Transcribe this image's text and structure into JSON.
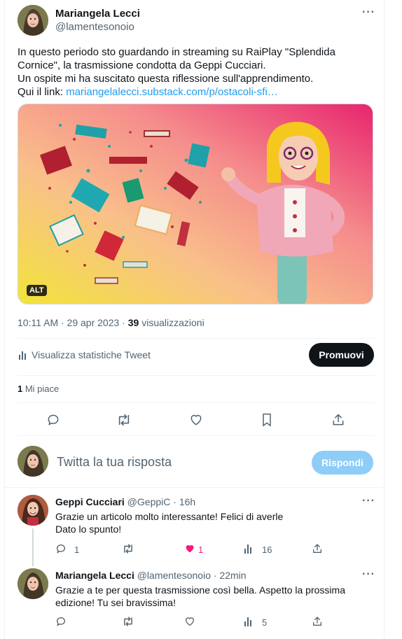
{
  "main_tweet": {
    "author_name": "Mariangela Lecci",
    "author_handle": "@lamentesonoio",
    "text_line1": "In questo periodo sto guardando in streaming su RaiPlay \"Splendida",
    "text_line2": "Cornice\", la trasmissione condotta da Geppi Cucciari.",
    "text_line3": "Un ospite mi ha suscitato questa riflessione sull'apprendimento.",
    "text_line4_prefix": "Qui il link: ",
    "text_link": "mariangelalecci.substack.com/p/ostacoli-sfi…",
    "alt_badge": "ALT",
    "timestamp": "10:11 AM · 29 apr 2023 · ",
    "views_count": "39",
    "views_label": " visualizzazioni",
    "stats_label": "Visualizza statistiche Tweet",
    "promote_label": "Promuovi",
    "likes_count": "1",
    "likes_label": " Mi piace"
  },
  "reply_box": {
    "placeholder": "Twitta la tua risposta",
    "button_label": "Rispondi"
  },
  "replies": [
    {
      "author_name": "Geppi Cucciari",
      "author_handle": "@GeppiC",
      "time": "· 16h",
      "line1": "Grazie un articolo molto interessante! Felici di averle",
      "line2": "Dato lo spunto!",
      "reply_count": "1",
      "like_count": "1",
      "views_count": "16"
    },
    {
      "author_name": "Mariangela Lecci",
      "author_handle": "@lamentesonoio",
      "time": "· 22min",
      "line1": "Grazie a te per questa trasmissione così bella. Aspetto la prossima",
      "line2": "edizione! Tu sei bravissima!",
      "views_count": "5"
    }
  ],
  "colors": {
    "accent": "#1d9bf0",
    "like": "#f91880",
    "text": "#0f1419",
    "muted": "#536471"
  },
  "icons": [
    "more-icon",
    "stats-icon",
    "reply-icon",
    "retweet-icon",
    "like-icon",
    "bookmark-icon",
    "share-icon",
    "views-icon"
  ]
}
